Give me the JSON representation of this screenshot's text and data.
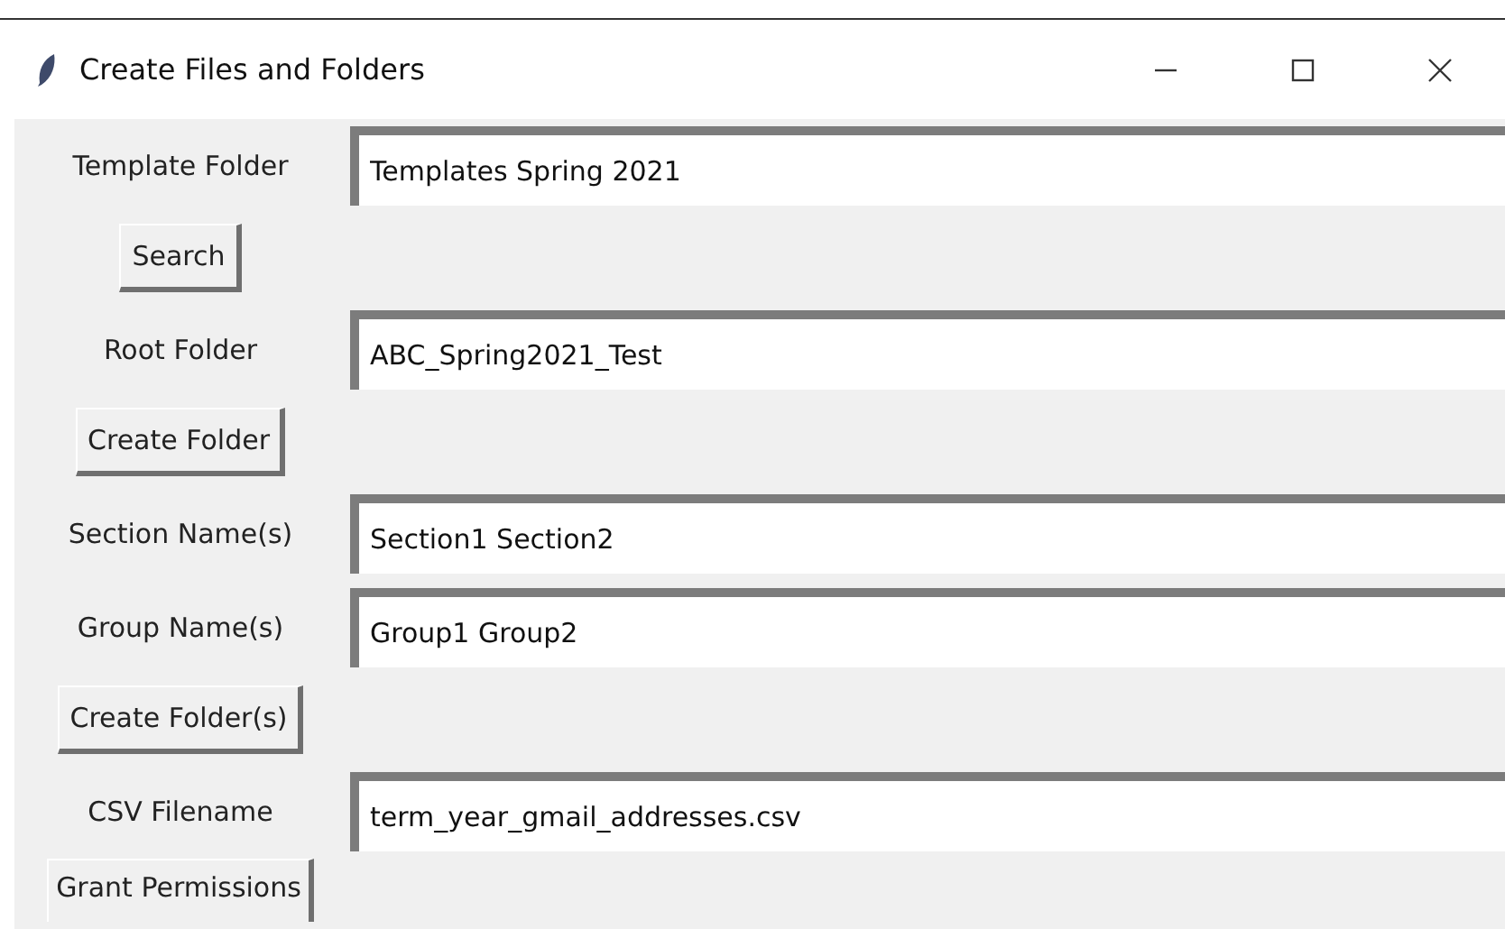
{
  "window": {
    "title": "Create Files and Folders"
  },
  "rows": [
    {
      "kind": "entry",
      "label": "Template Folder",
      "value": "Templates Spring 2021"
    },
    {
      "kind": "button",
      "label": "Search"
    },
    {
      "kind": "entry",
      "label": "Root Folder",
      "value": "ABC_Spring2021_Test"
    },
    {
      "kind": "button",
      "label": "Create Folder"
    },
    {
      "kind": "entry",
      "label": "Section Name(s)",
      "value": "Section1 Section2"
    },
    {
      "kind": "entry",
      "label": "Group Name(s)",
      "value": "Group1 Group2"
    },
    {
      "kind": "button",
      "label": "Create Folder(s)"
    },
    {
      "kind": "entry",
      "label": "CSV Filename",
      "value": "term_year_gmail_addresses.csv"
    },
    {
      "kind": "button",
      "label": "Grant Permissions"
    }
  ]
}
